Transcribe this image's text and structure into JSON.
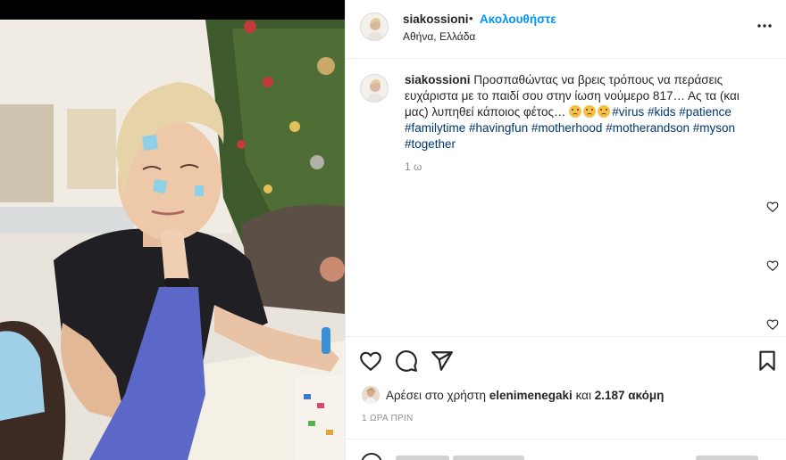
{
  "post": {
    "username": "siakossioni",
    "separator": "•",
    "follow_label": "Ακολουθήστε",
    "location": "Αθήνα, Ελλάδα",
    "more_icon": "more-horizontal-icon"
  },
  "caption": {
    "username": "siakossioni",
    "text": "Προσπαθώντας να βρεις τρόπους να περάσεις ευχάριστα με το παιδί σου στην ίωση νούμερο 817… Ας τα (και μας) λυπηθεί κάποιος φέτος…",
    "emoji": [
      "worried-face",
      "worried-face",
      "worried-face"
    ],
    "hashtags": [
      "#virus",
      "#kids",
      "#patience",
      "#familytime",
      "#havingfun",
      "#motherhood",
      "#motherandson",
      "#myson",
      "#together"
    ],
    "time": "1 ω"
  },
  "actions": {
    "like_icon": "heart-icon",
    "comment_icon": "comment-icon",
    "share_icon": "share-icon",
    "save_icon": "bookmark-icon"
  },
  "likes": {
    "prefix": "Αρέσει στο χρήστη",
    "user": "elenimenegaki",
    "conjunction": "και",
    "count": "2.187 ακόμη"
  },
  "timestamp": "1 ΩΡΑ ΠΡΙΝ",
  "colors": {
    "link": "#0095f6",
    "hashtag": "#00376b",
    "muted": "#8e8e8e",
    "text": "#262626",
    "border": "#efefef"
  }
}
